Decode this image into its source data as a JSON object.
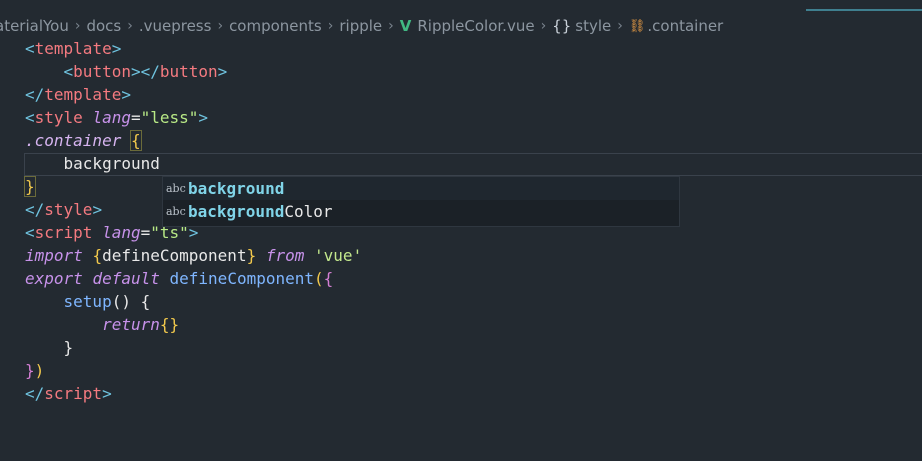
{
  "breadcrumb": {
    "items": [
      "aterialYou",
      "docs",
      ".vuepress",
      "components",
      "ripple"
    ],
    "file_icon": "V",
    "file": "RippleColor.vue",
    "style_icon": "{}",
    "style": "style",
    "symbol_icon": "⛓",
    "symbol": ".container",
    "separator": "›"
  },
  "code": {
    "l1": {
      "open": "<",
      "tag": "template",
      "close": ">"
    },
    "l2": {
      "open": "<",
      "tag": "button",
      "mid": "></",
      "tag2": "button",
      "close": ">"
    },
    "l3": {
      "open": "</",
      "tag": "template",
      "close": ">"
    },
    "l4": {
      "open": "<",
      "tag": "style",
      "attr": "lang",
      "eq": "=",
      "val": "\"less\"",
      "close": ">"
    },
    "l5": {
      "selector": ".container",
      "brace": "{"
    },
    "l6": {
      "text": "background"
    },
    "l7": {
      "brace": "}"
    },
    "l8": {
      "open": "</",
      "tag": "style",
      "close": ">"
    },
    "l9": {
      "open": "<",
      "tag": "script",
      "attr": "lang",
      "eq": "=",
      "val": "\"ts\"",
      "close": ">"
    },
    "l10": {
      "kw": "import",
      "b1": "{",
      "name": "defineComponent",
      "b2": "}",
      "from": "from",
      "mod": "'vue'"
    },
    "l11": {
      "kw1": "export",
      "kw2": "default",
      "fn": "defineComponent",
      "paren": "(",
      "brace": "{"
    },
    "l12": {
      "fn": "setup",
      "parens": "()",
      "brace": "{"
    },
    "l13": {
      "kw": "return",
      "braces": "{}"
    },
    "l14": {
      "brace": "}"
    },
    "l15": {
      "brace": "}",
      "paren": ")"
    },
    "l16": {
      "open": "</",
      "tag": "script",
      "close": ">"
    }
  },
  "suggest": {
    "icon": "abc",
    "items": [
      {
        "match": "background",
        "rest": ""
      },
      {
        "match": "background",
        "rest": "Color"
      }
    ]
  }
}
